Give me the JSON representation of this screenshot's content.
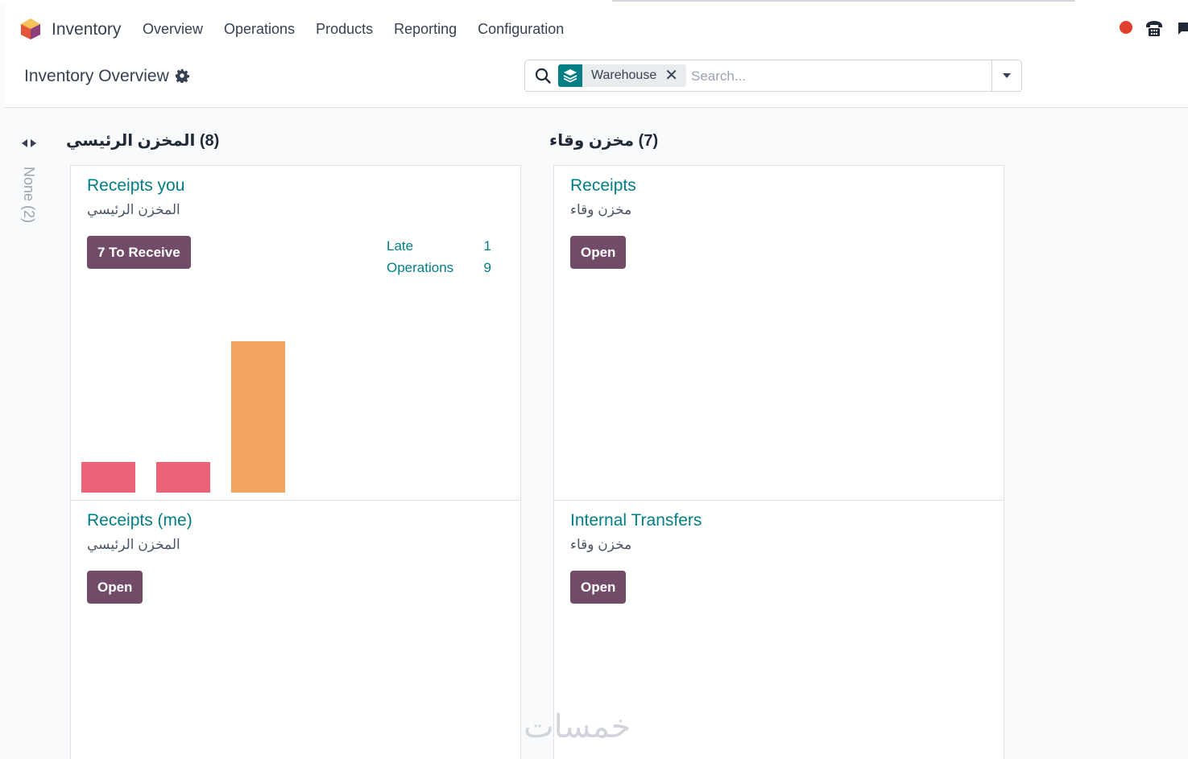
{
  "app": {
    "name": "Inventory"
  },
  "menu": [
    "Overview",
    "Operations",
    "Products",
    "Reporting",
    "Configuration"
  ],
  "control": {
    "title": "Inventory Overview",
    "facet_label": "Warehouse",
    "facet_close": "✕",
    "search_placeholder": "Search..."
  },
  "colors": {
    "accent": "#017e84",
    "brand": "#714b67",
    "bar_red": "#ec6379",
    "bar_orange": "#f2a35e"
  },
  "folded_group": "None (2)",
  "columns": [
    {
      "title": "(8) المخزن الرئيسي"
    },
    {
      "title": "(7) مخزن وقاء"
    }
  ],
  "cards": [
    {
      "title": "Receipts you",
      "warehouse": "المخزن الرئيسي",
      "button": "7 To Receive",
      "stats": [
        {
          "label": "Late",
          "value": "1"
        },
        {
          "label": "Operations",
          "value": "9"
        }
      ],
      "graph": [
        {
          "value": 1,
          "color": "red"
        },
        {
          "value": 1,
          "color": "red"
        },
        {
          "value": 5,
          "color": "orange"
        }
      ]
    },
    {
      "title": "Receipts",
      "warehouse": "مخزن وقاء",
      "button": "Open"
    },
    {
      "title": "Receipts (me)",
      "warehouse": "المخزن الرئيسي",
      "button": "Open"
    },
    {
      "title": "Internal Transfers",
      "warehouse": "مخزن وقاء",
      "button": "Open"
    }
  ],
  "watermark": "خمسات"
}
